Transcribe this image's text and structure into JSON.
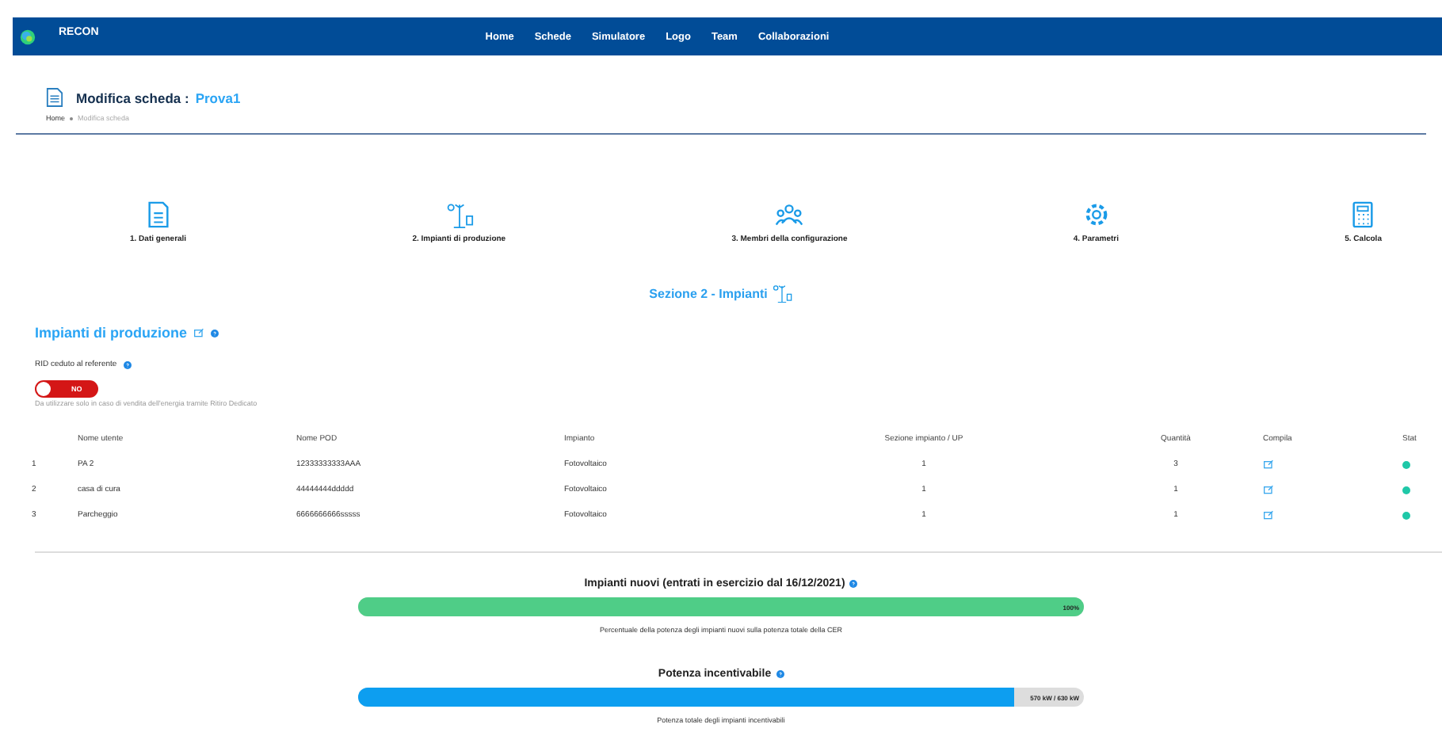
{
  "navbar": {
    "brand": "RECON",
    "links": [
      "Home",
      "Schede",
      "Simulatore",
      "Logo",
      "Team",
      "Collaborazioni"
    ]
  },
  "header": {
    "title": "Modifica scheda :",
    "name": "Prova1",
    "breadcrumb": [
      "Home",
      "Modifica scheda"
    ]
  },
  "steps": [
    {
      "kind": "document",
      "label": "1. Dati generali"
    },
    {
      "kind": "plants",
      "label": "2. Impianti di produzione"
    },
    {
      "kind": "people",
      "label": "3. Membri della configurazione"
    },
    {
      "kind": "gear",
      "label": "4. Parametri"
    },
    {
      "kind": "calculator",
      "label": "5. Calcola"
    }
  ],
  "section_title": "Sezione 2 - Impianti",
  "panel": {
    "title": "Impianti di produzione",
    "rid_label": "RID ceduto al referente",
    "toggle": {
      "on": false,
      "label": "NO"
    },
    "hint": "Da utilizzare solo in caso di vendita dell'energia tramite Ritiro Dedicato"
  },
  "table": {
    "columns": [
      "",
      "Nome utente",
      "Nome POD",
      "Impianto",
      "Sezione impianto / UP",
      "Quantità",
      "Compila",
      "Stat"
    ],
    "rows": [
      {
        "index": "1",
        "user": "PA 2",
        "pod": "12333333333AAA",
        "plant": "Fotovoltaico",
        "section": "1",
        "qty": "3",
        "color": "#1fc8a8"
      },
      {
        "index": "2",
        "user": "casa di cura",
        "pod": "44444444ddddd",
        "plant": "Fotovoltaico",
        "section": "1",
        "qty": "1",
        "color": "#1fc8a8"
      },
      {
        "index": "3",
        "user": "Parcheggio",
        "pod": "6666666666sssss",
        "plant": "Fotovoltaico",
        "section": "1",
        "qty": "1",
        "color": "#1fc8a8"
      }
    ]
  },
  "meters": [
    {
      "title": "Impianti nuovi (entrati in esercizio dal 16/12/2021)",
      "level": 1,
      "reading": "100%",
      "color": "#4fcd87",
      "caption": "Percentuale della potenza degli impianti nuovi sulla potenza totale della CER"
    },
    {
      "title": "Potenza incentivabile",
      "level": 0.905,
      "reading": "570 kW / 630 kW",
      "color": "#0d9ef0",
      "caption": "Potenza totale degli impianti incentivabili"
    }
  ]
}
